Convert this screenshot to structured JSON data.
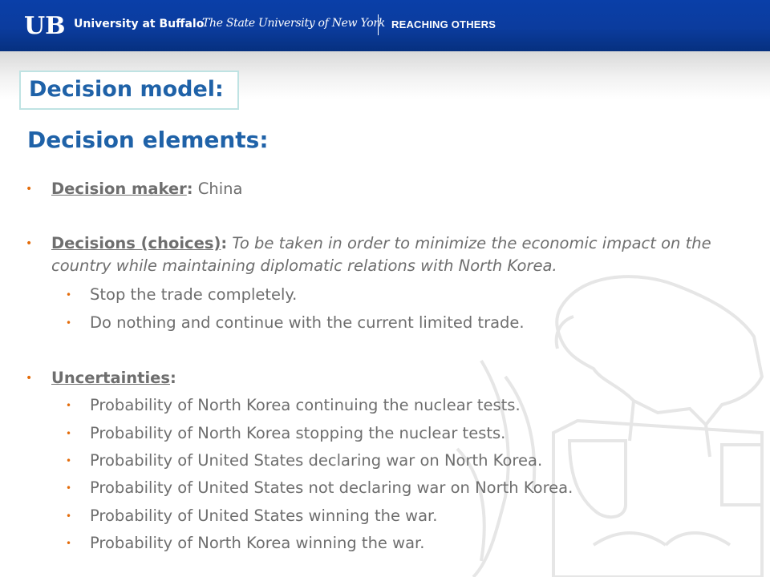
{
  "header": {
    "logo_letters": "UB",
    "university_name": "University at Buffalo",
    "system_name": "The State University of New York",
    "tagline": "REACHING OTHERS"
  },
  "slide": {
    "title": "Decision model:",
    "subtitle": "Decision elements:",
    "bullets": [
      {
        "label": "Decision maker",
        "colon": ":",
        "text": " China"
      },
      {
        "label": "Decisions (choices)",
        "colon": ":",
        "text": " To be taken in order to minimize the economic impact on the country while maintaining diplomatic relations with North Korea."
      },
      {
        "label": "Uncertainties",
        "colon": ":",
        "text": ""
      }
    ],
    "decision_options": [
      "Stop the trade completely.",
      "Do nothing and continue with the current limited trade."
    ],
    "uncertainty_items": [
      "Probability of North Korea continuing the nuclear tests.",
      "Probability of North Korea stopping the nuclear tests.",
      "Probability of United States declaring war on North Korea.",
      "Probability of United States not declaring war on North Korea.",
      "Probability of United States winning the war.",
      "Probability of North Korea winning the war."
    ]
  },
  "colors": {
    "banner": "#0b3c9e",
    "heading": "#1f62a8",
    "bullet": "#e46c0a",
    "body_text": "#6e6e6e"
  }
}
